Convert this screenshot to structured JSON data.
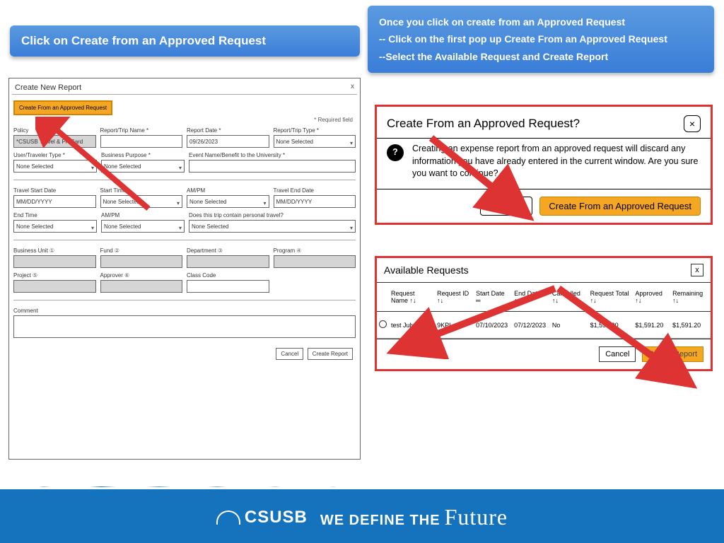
{
  "callout_left": "Click on Create from an Approved Request",
  "callout_right": {
    "l1": "Once you click on create from an Approved Request",
    "l2": "-- Click on the first pop up Create From an Approved Request",
    "l3": "--Select the Available Request and Create Report"
  },
  "form": {
    "title": "Create New Report",
    "close": "x",
    "approve_btn": "Create From an Approved Request",
    "required_hint": "* Required field",
    "labels": {
      "policy": "Policy",
      "trip_name": "Report/Trip Name *",
      "report_date": "Report Date *",
      "trip_type": "Report/Trip Type *",
      "user_type": "User/Traveler Type *",
      "business_purpose": "Business Purpose *",
      "event_name": "Event Name/Benefit to the University *",
      "travel_start": "Travel Start Date",
      "start_time": "Start Time",
      "ampm1": "AM/PM",
      "travel_end": "Travel End Date",
      "end_time": "End Time",
      "ampm2": "AM/PM",
      "personal": "Does this trip contain personal travel?",
      "business_unit": "Business Unit",
      "fund": "Fund",
      "department": "Department",
      "program": "Program",
      "project": "Project",
      "approver": "Approver",
      "class_code": "Class Code",
      "comment": "Comment"
    },
    "values": {
      "policy": "*CSUSB Travel & ProCard",
      "report_date": "09/26/2023",
      "none": "None Selected",
      "mmdd": "MM/DD/YYYY"
    },
    "footer": {
      "cancel": "Cancel",
      "create": "Create Report"
    }
  },
  "dialog": {
    "title": "Create From an Approved Request?",
    "body": "Creating an expense report from an approved request will discard any information you have already entered in the current window. Are you sure you want to continue?",
    "go_back": "Go back",
    "confirm": "Create From an Approved Request",
    "close": "×"
  },
  "avail": {
    "title": "Available Requests",
    "close": "x",
    "headers": [
      "",
      "Request Name ↑↓",
      "Request ID ↑↓",
      "Start Date ═",
      "End Date ↑↓",
      "Cancelled ↑↓",
      "Request Total ↑↓",
      "Approved ↑↓",
      "Remaining ↑↓"
    ],
    "row": {
      "name": "test July 2023",
      "id": "9KPL",
      "start": "07/10/2023",
      "end": "07/12/2023",
      "cancelled": "No",
      "total": "$1,591.20",
      "approved": "$1,591.20",
      "remaining": "$1,591.20"
    },
    "cancel": "Cancel",
    "create": "Create Report"
  },
  "footer": {
    "brand": "CSUSB",
    "tag1": "WE DEFINE THE",
    "tag2": "Future"
  }
}
